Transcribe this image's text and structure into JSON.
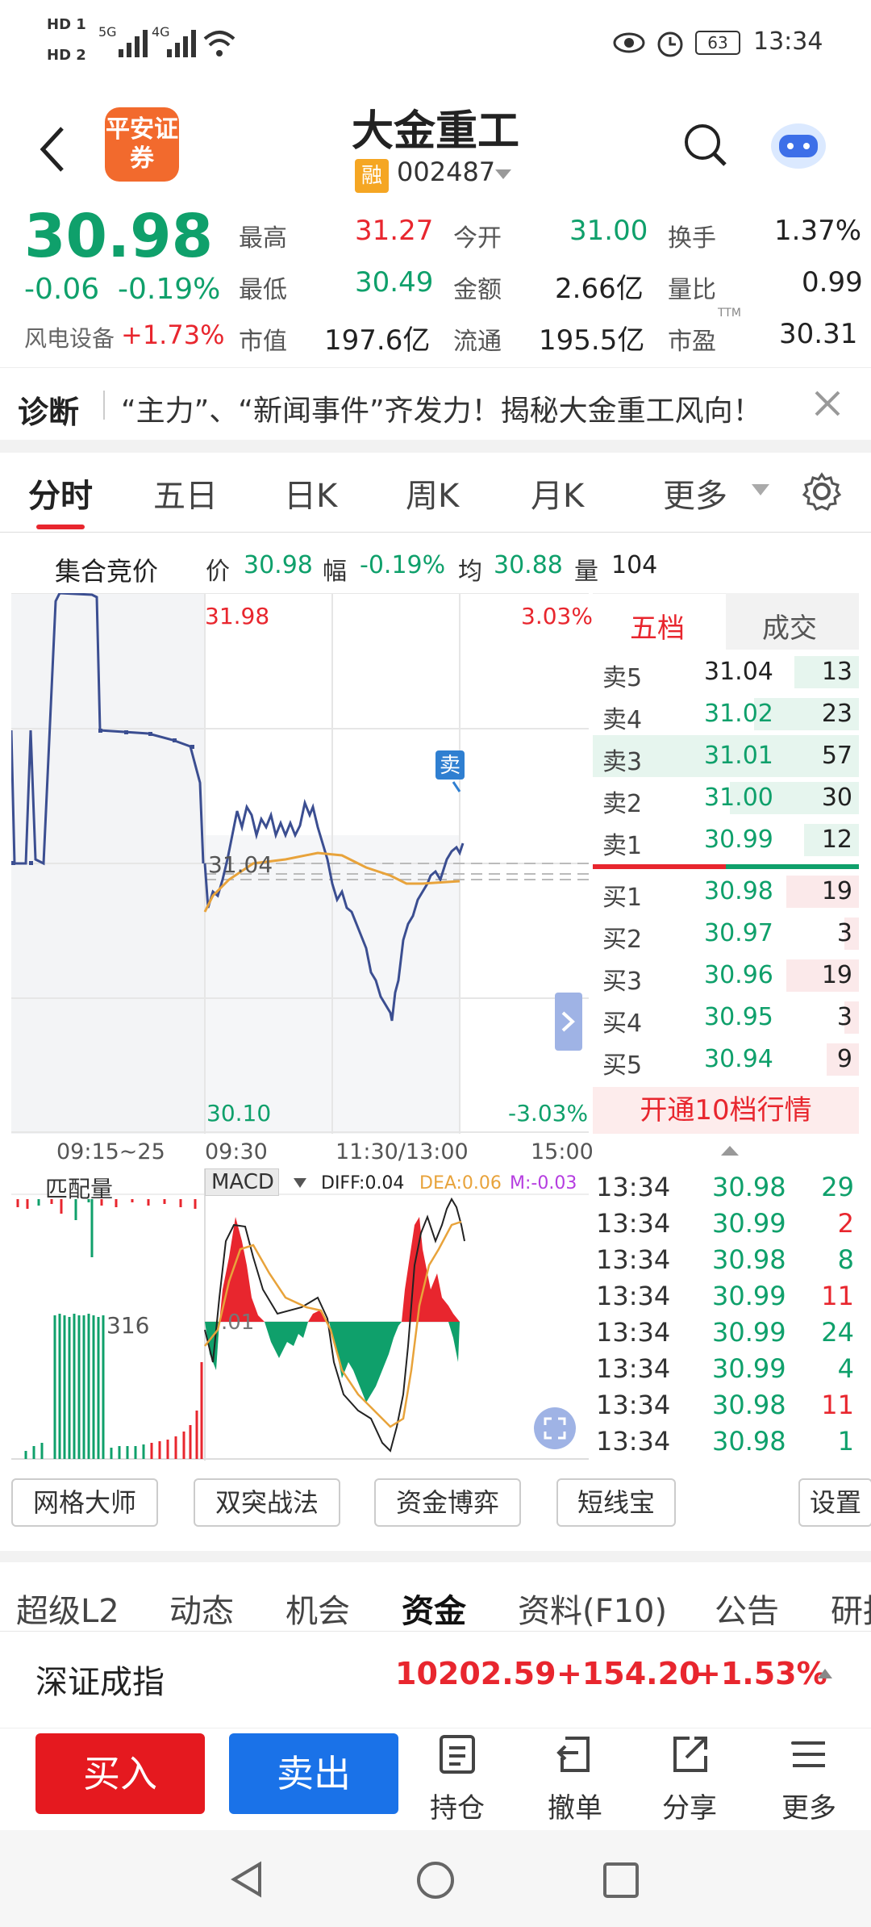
{
  "status_bar": {
    "hd1": "HD 1",
    "hd2": "HD 2",
    "sig1": "5G",
    "sig2": "4G",
    "battery": "63",
    "time": "13:34"
  },
  "header": {
    "broker_logo_text": "平安证券",
    "stock_name": "大金重工",
    "margin_badge": "融",
    "stock_code": "002487"
  },
  "quote": {
    "price": "30.98",
    "change": "-0.06",
    "change_pct": "-0.19%",
    "sector_name": "风电设备",
    "sector_change": "+1.73%",
    "fields": [
      {
        "label": "最高",
        "value": "31.27"
      },
      {
        "label": "今开",
        "value": "31.00"
      },
      {
        "label": "换手",
        "value": "1.37%"
      },
      {
        "label": "最低",
        "value": "30.49"
      },
      {
        "label": "金额",
        "value": "2.66亿"
      },
      {
        "label": "量比",
        "value": "0.99"
      },
      {
        "label": "市值",
        "value": "197.6亿"
      },
      {
        "label": "流通",
        "value": "195.5亿"
      },
      {
        "label": "市盈",
        "value": "30.31"
      }
    ],
    "ttm": "TTM"
  },
  "diagnosis": {
    "label": "诊断",
    "text": "“主力”、“新闻事件”齐发力！揭秘大金重工风向！"
  },
  "chart_tabs": [
    "分时",
    "五日",
    "日K",
    "周K",
    "月K",
    "更多"
  ],
  "chart_info": {
    "auction_label": "集合竞价",
    "price_label": "价",
    "price": "30.98",
    "amp_label": "幅",
    "amp": "-0.19%",
    "avg_label": "均",
    "avg": "30.88",
    "vol_label": "量",
    "vol": "104"
  },
  "chart": {
    "y_top": "31.98",
    "y_bottom": "30.10",
    "pct_top": "3.03%",
    "pct_bottom": "-3.03%",
    "ref_label": "31.04",
    "sell_marker": "卖",
    "x_labels": [
      "09:15~25",
      "09:30",
      "11:30/13:00",
      "15:00"
    ],
    "vol_title": "匹配量",
    "vol_ref": "316",
    "indicator": "MACD",
    "diff": "DIFF:0.04",
    "dea": "DEA:0.06",
    "m": "M:-0.03",
    "macd_zero": ".01"
  },
  "order_book": {
    "tabs": [
      "五档",
      "成交"
    ],
    "asks": [
      {
        "label": "卖5",
        "price": "31.04",
        "vol": "13"
      },
      {
        "label": "卖4",
        "price": "31.02",
        "vol": "23"
      },
      {
        "label": "卖3",
        "price": "31.01",
        "vol": "57"
      },
      {
        "label": "卖2",
        "price": "31.00",
        "vol": "30"
      },
      {
        "label": "卖1",
        "price": "30.99",
        "vol": "12"
      }
    ],
    "bids": [
      {
        "label": "买1",
        "price": "30.98",
        "vol": "19"
      },
      {
        "label": "买2",
        "price": "30.97",
        "vol": "3"
      },
      {
        "label": "买3",
        "price": "30.96",
        "vol": "19"
      },
      {
        "label": "买4",
        "price": "30.95",
        "vol": "3"
      },
      {
        "label": "买5",
        "price": "30.94",
        "vol": "9"
      }
    ],
    "upgrade_text": "开通10档行情"
  },
  "ticks": [
    {
      "time": "13:34",
      "price": "30.98",
      "vol": "29"
    },
    {
      "time": "13:34",
      "price": "30.99",
      "vol": "2"
    },
    {
      "time": "13:34",
      "price": "30.98",
      "vol": "8"
    },
    {
      "time": "13:34",
      "price": "30.99",
      "vol": "11"
    },
    {
      "time": "13:34",
      "price": "30.99",
      "vol": "24"
    },
    {
      "time": "13:34",
      "price": "30.99",
      "vol": "4"
    },
    {
      "time": "13:34",
      "price": "30.98",
      "vol": "11"
    },
    {
      "time": "13:34",
      "price": "30.98",
      "vol": "1"
    }
  ],
  "tools": [
    "网格大师",
    "双突战法",
    "资金博弈",
    "短线宝",
    "设置"
  ],
  "info_tabs": [
    "超级L2",
    "动态",
    "机会",
    "资金",
    "资料(F10)",
    "公告",
    "研报"
  ],
  "index": {
    "name": "深证成指",
    "value": "10202.59",
    "change": "+154.20",
    "pct": "+1.53%"
  },
  "bottom": {
    "buy": "买入",
    "sell": "卖出",
    "items": [
      "持仓",
      "撤单",
      "分享",
      "更多"
    ]
  }
}
